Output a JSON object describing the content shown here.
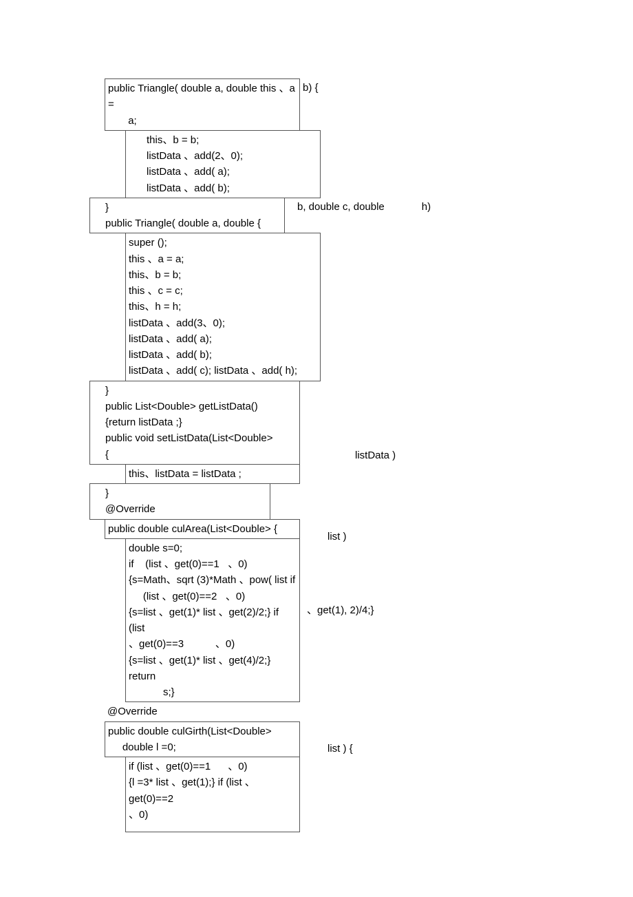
{
  "b1": {
    "left": "public Triangle( double a, double this 、a =\n       a;",
    "right": "b) {"
  },
  "b2": {
    "l1": "this、b = b;",
    "l2": "listData 、add(2、0);",
    "l3": "listData   、add( a);",
    "l4": "listData   、add( b);"
  },
  "b3": {
    "left": "}\npublic Triangle( double a, double {",
    "right1": "b, double c, double",
    "right2": "h)"
  },
  "b4": {
    "l1": "super ();",
    "l2": "this 、a = a;",
    "l3": "this、b = b;",
    "l4": "this 、c = c;",
    "l5": "this、h = h;",
    "l6": "listData 、add(3、0);",
    "l7": "listData 、add( a);",
    "l8": "listData 、add( b);",
    "l9": "listData 、add( c); listData 、add( h);"
  },
  "b5": {
    "left": "}\npublic List<Double> getListData()\n{return listData ;}\npublic void setListData(List<Double>\n{",
    "right": "listData )"
  },
  "b6": "this、listData = listData ;",
  "b7": "}\n@Override",
  "b8": {
    "top": "public double culArea(List<Double> {",
    "right": "list )",
    "body": "double s=0;\nif    (list 、get(0)==1   、0)\n{s=Math、sqrt (3)*Math 、pow( list if\n     (list 、get(0)==2   、0)\n{s=list 、get(1)* list 、get(2)/2;} if  (list\n、get(0)==3           、0)\n{s=list 、get(1)* list 、get(4)/2;} return\n            s;}",
    "right2": "、get(1), 2)/4;}"
  },
  "b9": "@Override",
  "b10": {
    "top": "public double culGirth(List<Double>\n     double l =0;",
    "right": "list ) {",
    "body": "if (list 、get(0)==1      、0)\n{l =3* list 、get(1);} if (list 、get(0)==2\n、0)"
  }
}
